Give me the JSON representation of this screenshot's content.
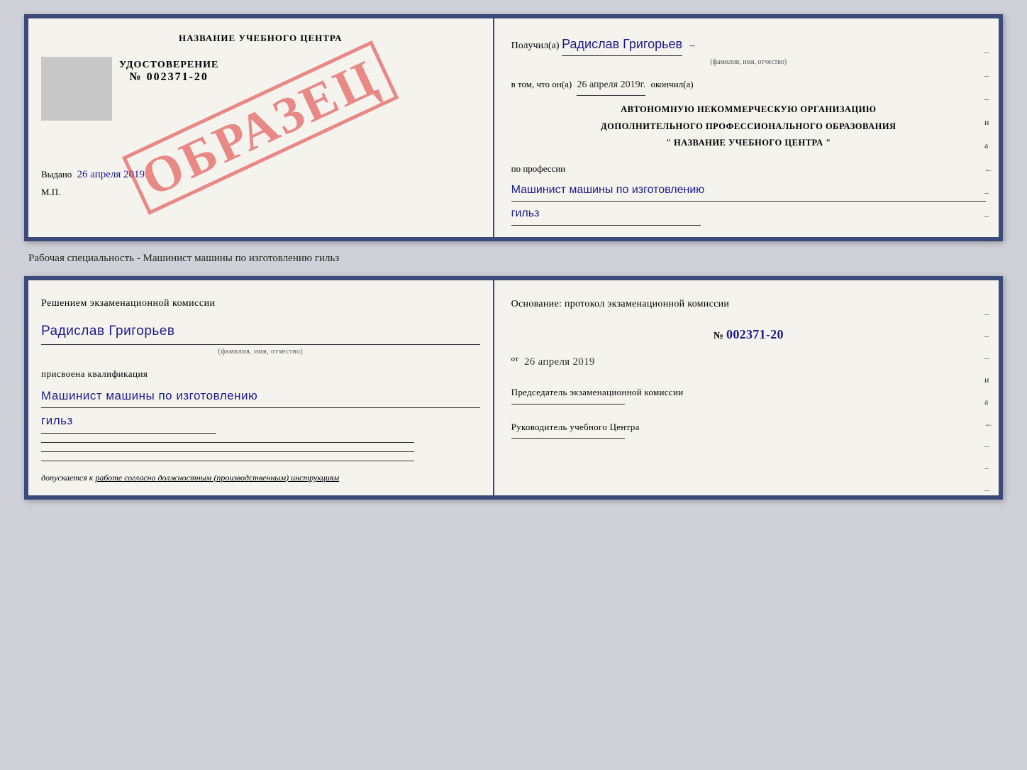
{
  "top_doc": {
    "left": {
      "header": "НАЗВАНИЕ УЧЕБНОГО ЦЕНТРА",
      "cert_title": "УДОСТОВЕРЕНИЕ",
      "cert_number": "№ 002371-20",
      "issued_label": "Выдано",
      "issued_date": "26 апреля 2019",
      "mp_label": "М.П.",
      "stamp_text": "ОБРАЗЕЦ"
    },
    "right": {
      "received_prefix": "Получил(а)",
      "person_name": "Радислав Григорьев",
      "name_hint": "(фамилия, имя, отчество)",
      "date_prefix": "в том, что он(а)",
      "date_value": "26 апреля 2019г.",
      "date_suffix": "окончил(а)",
      "org_line1": "АВТОНОМНУЮ НЕКОММЕРЧЕСКУЮ ОРГАНИЗАЦИЮ",
      "org_line2": "ДОПОЛНИТЕЛЬНОГО ПРОФЕССИОНАЛЬНОГО ОБРАЗОВАНИЯ",
      "org_line3": "\" НАЗВАНИЕ УЧЕБНОГО ЦЕНТРА \"",
      "profession_label": "по профессии",
      "profession_value": "Машинист машины по изготовлению",
      "profession_value2": "гильз",
      "side_marks": [
        "-",
        "-",
        "-",
        "и",
        "а",
        "←",
        "-",
        "-",
        "-"
      ]
    }
  },
  "between_label": "Рабочая специальность - Машинист машины по изготовлению гильз",
  "bottom_doc": {
    "left": {
      "decision_text": "Решением  экзаменационной  комиссии",
      "person_name": "Радислав Григорьев",
      "name_hint": "(фамилия, имя, отчество)",
      "qualification_prefix": "присвоена квалификация",
      "qualification_value": "Машинист машины по изготовлению",
      "qualification_value2": "гильз",
      "footer_text": "допускается к",
      "footer_underline": "работе согласно должностным (производственным) инструкциям"
    },
    "right": {
      "basis_text": "Основание: протокол экзаменационной  комиссии",
      "number_label": "№",
      "number_value": "002371-20",
      "date_prefix": "от",
      "date_value": "26 апреля 2019",
      "chairman_label": "Председатель экзаменационной комиссии",
      "director_label": "Руководитель учебного Центра",
      "side_marks": [
        "-",
        "-",
        "-",
        "и",
        "а",
        "←",
        "-",
        "-",
        "-"
      ]
    }
  }
}
